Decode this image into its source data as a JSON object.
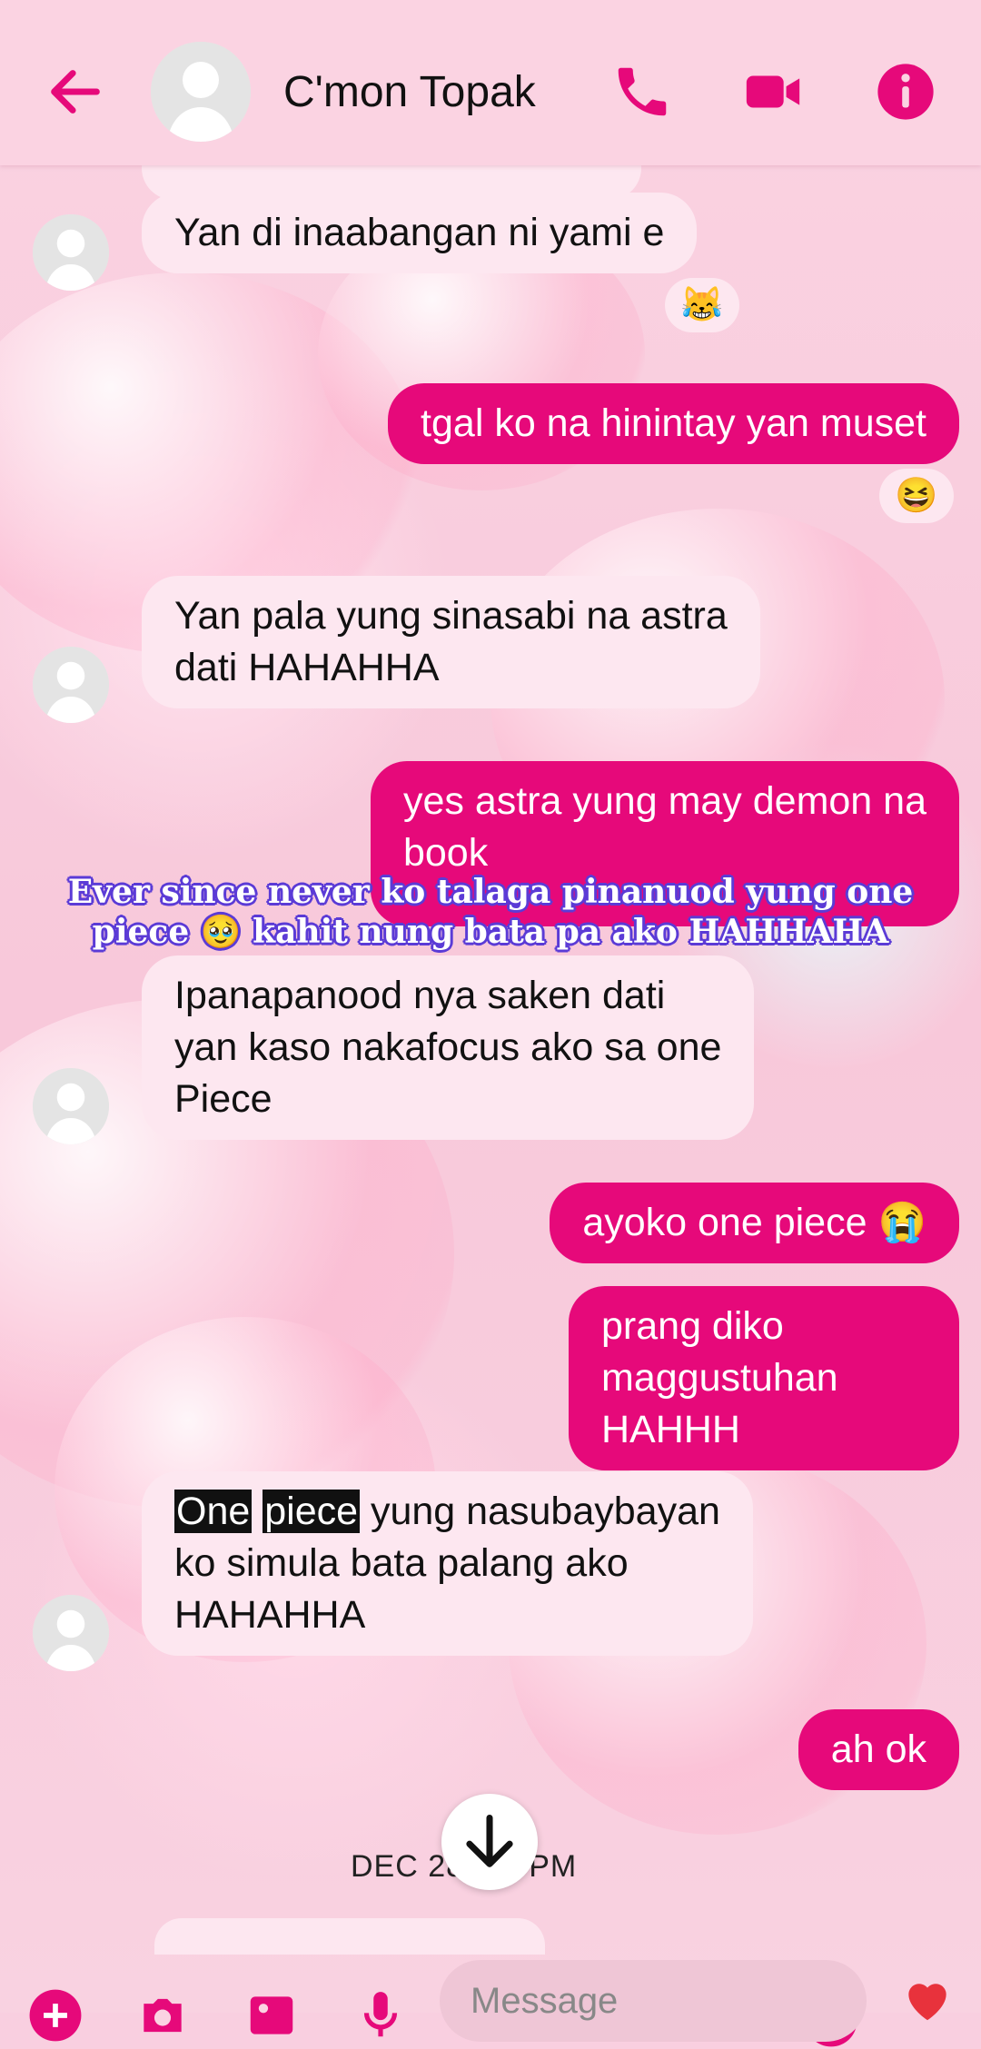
{
  "header": {
    "title": "C'mon Topak"
  },
  "messages": {
    "m1": "Yan di inaabangan ni yami e",
    "m1_react": "😹",
    "m2": "tgal ko na hinintay yan muset",
    "m2_react": "😆",
    "m3_line1": "Yan pala yung sinasabi na astra",
    "m3_line2": "dati HAHAHHA",
    "m4_line1": "yes astra yung may demon na",
    "m4_line2": "book",
    "m5_line1": "Ipanapanood nya saken dati",
    "m5_line2": "yan kaso nakafocus ako sa one",
    "m5_line3": "Piece",
    "m6": "ayoko one piece 😭",
    "m7_line1": "prang diko maggustuhan",
    "m7_line2": "HAHHH",
    "m8_hl1": "One",
    "m8_hl2": "piece",
    "m8_rest": " yung nasubaybayan",
    "m8_line2": "ko simula bata palang ako",
    "m8_line3": "HAHAHHA",
    "m9": "ah ok"
  },
  "caption": {
    "line1": "Ever since never ko talaga pinanuod yung one",
    "line2": "piece 🥹 kahit nung bata pa ako HAHHAHA"
  },
  "date_divider": "DEC 28    .51 PM",
  "composer": {
    "placeholder": "Message"
  },
  "colors": {
    "accent": "#e6097a",
    "incoming_bubble": "#fde7f0",
    "header_bg": "#fbd3e2"
  }
}
